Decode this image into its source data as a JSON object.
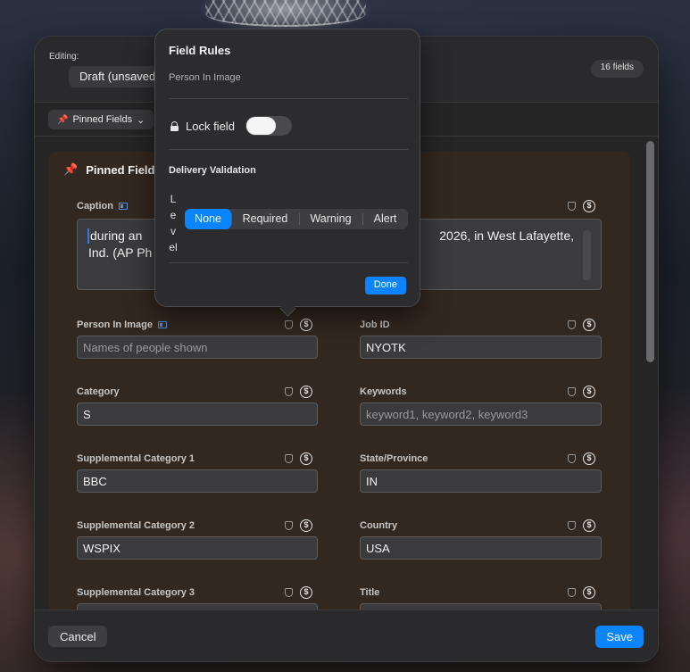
{
  "header": {
    "editing_label": "Editing:",
    "draft_value": "Draft (unsaved)",
    "fields_count": "16 fields"
  },
  "toolbar": {
    "pinned_label": "Pinned Fields"
  },
  "pinned_card": {
    "title": "Pinned Fields"
  },
  "fields": {
    "caption": {
      "label": "Caption",
      "value_line1": "during an",
      "value_line1_end": "2026, in West Lafayette,",
      "value_line2": "Ind. (AP Ph"
    },
    "person_in_image": {
      "label": "Person In Image",
      "placeholder": "Names of people shown"
    },
    "job_id": {
      "label": "Job ID",
      "value": "NYOTK"
    },
    "category": {
      "label": "Category",
      "value": "S"
    },
    "keywords": {
      "label": "Keywords",
      "placeholder": "keyword1, keyword2, keyword3"
    },
    "supp_cat_1": {
      "label": "Supplemental Category 1",
      "value": "BBC"
    },
    "state_province": {
      "label": "State/Province",
      "value": "IN"
    },
    "supp_cat_2": {
      "label": "Supplemental Category 2",
      "value": "WSPIX"
    },
    "country": {
      "label": "Country",
      "value": "USA"
    },
    "supp_cat_3": {
      "label": "Supplemental Category 3"
    },
    "title": {
      "label": "Title"
    }
  },
  "footer": {
    "cancel_label": "Cancel",
    "save_label": "Save"
  },
  "popover": {
    "title": "Field Rules",
    "subtitle": "Person In Image",
    "lock_label": "Lock field",
    "lock_enabled": false,
    "section_title": "Delivery Validation",
    "level_label": "Level",
    "levels": [
      "None",
      "Required",
      "Warning",
      "Alert"
    ],
    "selected_level": "None",
    "done_label": "Done"
  },
  "colors": {
    "accent": "#0a84ff",
    "pin": "#e8912c",
    "card_bg": "#33281f"
  }
}
